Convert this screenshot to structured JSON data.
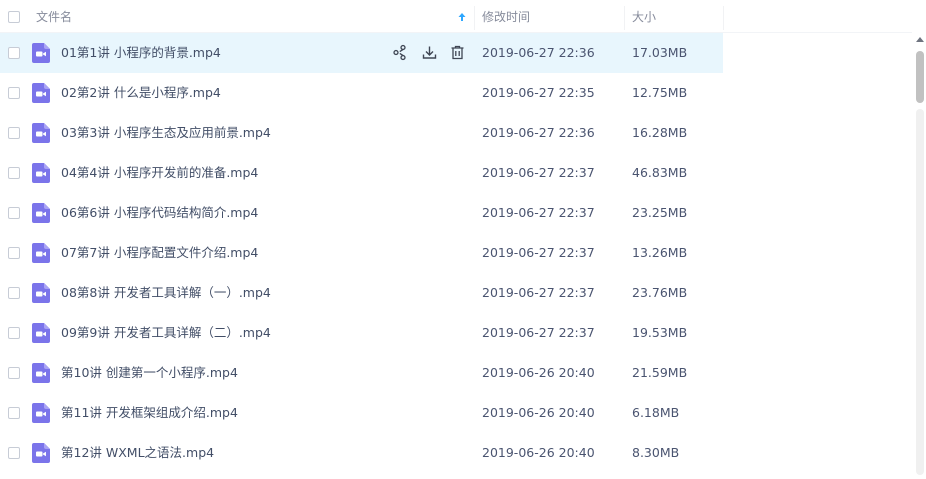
{
  "header": {
    "col_name": "文件名",
    "col_modified": "修改时间",
    "col_size": "大小"
  },
  "colors": {
    "hover_row": "#e8f6fd",
    "video_icon": "#7b74ea",
    "sort_arrow": "#2ea7ff",
    "action_icon": "#3f4654"
  },
  "files": [
    {
      "name": "01第1讲 小程序的背景.mp4",
      "modified": "2019-06-27 22:36",
      "size": "17.03MB"
    },
    {
      "name": "02第2讲 什么是小程序.mp4",
      "modified": "2019-06-27 22:35",
      "size": "12.75MB"
    },
    {
      "name": "03第3讲 小程序生态及应用前景.mp4",
      "modified": "2019-06-27 22:36",
      "size": "16.28MB"
    },
    {
      "name": "04第4讲 小程序开发前的准备.mp4",
      "modified": "2019-06-27 22:37",
      "size": "46.83MB"
    },
    {
      "name": "06第6讲 小程序代码结构简介.mp4",
      "modified": "2019-06-27 22:37",
      "size": "23.25MB"
    },
    {
      "name": "07第7讲 小程序配置文件介绍.mp4",
      "modified": "2019-06-27 22:37",
      "size": "13.26MB"
    },
    {
      "name": "08第8讲 开发者工具详解（一）.mp4",
      "modified": "2019-06-27 22:37",
      "size": "23.76MB"
    },
    {
      "name": "09第9讲 开发者工具详解（二）.mp4",
      "modified": "2019-06-27 22:37",
      "size": "19.53MB"
    },
    {
      "name": "第10讲 创建第一个小程序.mp4",
      "modified": "2019-06-26 20:40",
      "size": "21.59MB"
    },
    {
      "name": "第11讲 开发框架组成介绍.mp4",
      "modified": "2019-06-26 20:40",
      "size": "6.18MB"
    },
    {
      "name": "第12讲 WXML之语法.mp4",
      "modified": "2019-06-26 20:40",
      "size": "8.30MB"
    }
  ],
  "row_actions": {
    "share_icon": "share-icon",
    "download_icon": "download-icon",
    "delete_icon": "trash-icon"
  }
}
